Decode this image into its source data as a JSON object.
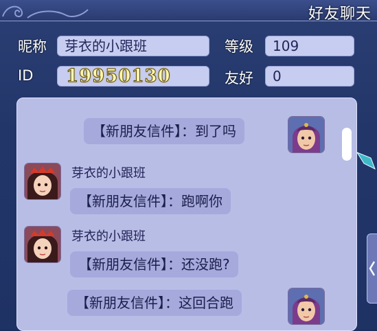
{
  "window": {
    "title": "好友聊天"
  },
  "profile": {
    "nickname_label": "昵称",
    "nickname_value": "芽衣的小跟班",
    "level_label": "等级",
    "level_value": "109",
    "id_label": "ID",
    "id_value": "19950130",
    "friendship_label": "友好",
    "friendship_value": "0"
  },
  "chat": {
    "messages": [
      {
        "side": "right",
        "text": "【新朋友信件】：到了吗"
      },
      {
        "side": "left",
        "sender": "芽衣的小跟班",
        "text": "【新朋友信件】：跑啊你"
      },
      {
        "side": "left",
        "sender": "芽衣的小跟班",
        "text": "【新朋友信件】：还没跑?"
      },
      {
        "side": "right",
        "text": "【新朋友信件】：这回合跑"
      }
    ]
  },
  "icons": {
    "swirl": "cloud-swirl-icon",
    "self_avatar": "self-avatar",
    "friend_avatar": "friend-avatar",
    "side_tab": "chevron-left-icon"
  },
  "colors": {
    "panel": "#22366a",
    "chat_bg": "#b8bde6",
    "bubble": "#a5a9dc",
    "field": "#c7cdf0"
  }
}
